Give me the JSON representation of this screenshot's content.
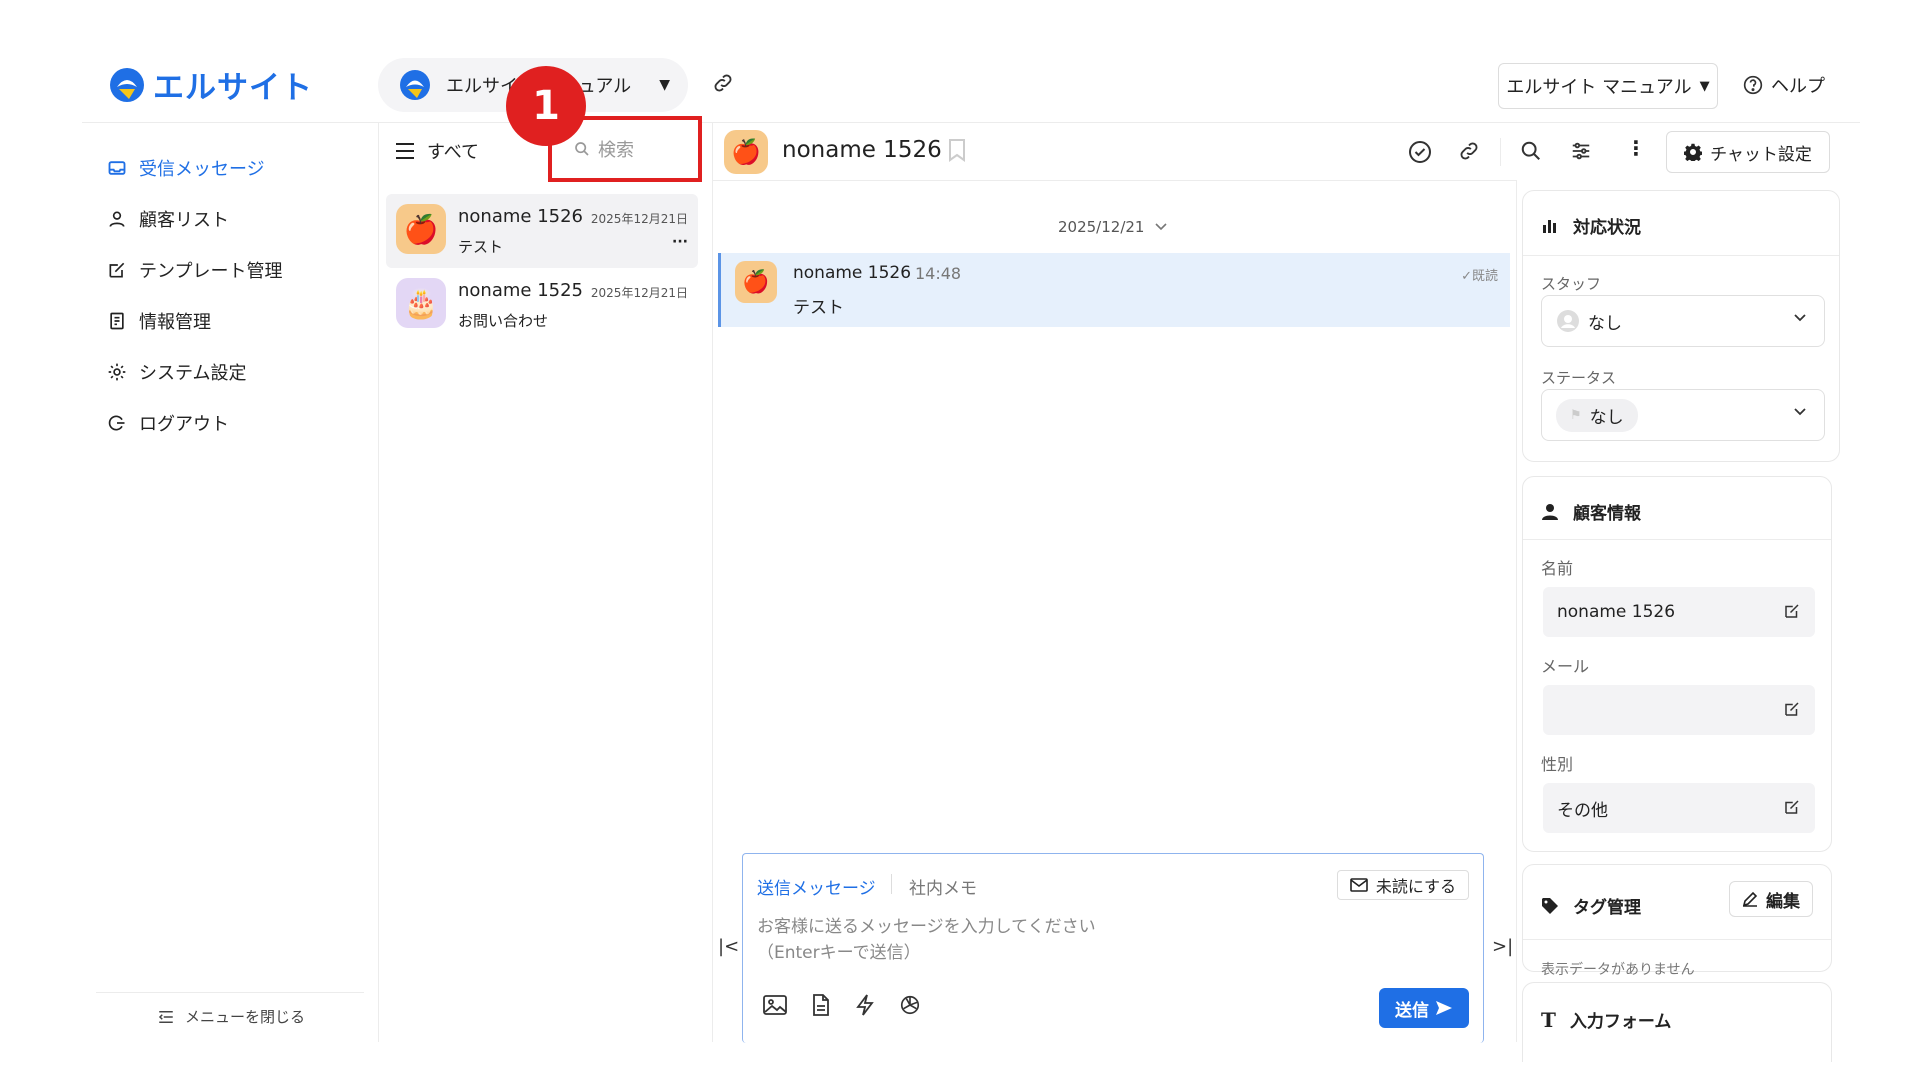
{
  "brand": {
    "name": "エルサイト"
  },
  "account": {
    "name": "エルサイト マニュアル"
  },
  "header": {
    "manual_label": "エルサイト マニュアル",
    "help_label": "ヘルプ"
  },
  "sidebar": {
    "items": [
      {
        "label": "受信メッセージ",
        "icon": "inbox-icon",
        "active": true
      },
      {
        "label": "顧客リスト",
        "icon": "user-icon"
      },
      {
        "label": "テンプレート管理",
        "icon": "edit-icon"
      },
      {
        "label": "情報管理",
        "icon": "info-icon"
      },
      {
        "label": "システム設定",
        "icon": "gear-icon"
      },
      {
        "label": "ログアウト",
        "icon": "logout-icon"
      }
    ],
    "close_label": "メニューを閉じる"
  },
  "list": {
    "filter_label": "すべて",
    "search_placeholder": "検索",
    "annotation_number": "1",
    "conversations": [
      {
        "name": "noname 1526",
        "date": "2025年12月21日",
        "preview": "テスト",
        "avatar": "apple"
      },
      {
        "name": "noname 1525",
        "date": "2025年12月21日",
        "preview": "お問い合わせ",
        "avatar": "cake"
      }
    ]
  },
  "chat": {
    "title": "noname 1526",
    "settings_label": "チャット設定",
    "date_separator": "2025/12/21",
    "messages": [
      {
        "sender": "noname 1526",
        "time": "14:48",
        "status": "既読",
        "text": "テスト"
      }
    ]
  },
  "composer": {
    "tab_send": "送信メッセージ",
    "tab_memo": "社内メモ",
    "unread_label": "未読にする",
    "placeholder_line1": "お客様に送るメッセージを入力してください",
    "placeholder_line2": "（Enterキーで送信）",
    "send_label": "送信"
  },
  "panel": {
    "status_card": {
      "title": "対応状況",
      "staff_label": "スタッフ",
      "staff_value": "なし",
      "status_label": "ステータス",
      "status_value": "なし"
    },
    "customer_card": {
      "title": "顧客情報",
      "name_label": "名前",
      "name_value": "noname 1526",
      "email_label": "メール",
      "email_value": "",
      "gender_label": "性別",
      "gender_value": "その他"
    },
    "tag_card": {
      "title": "タグ管理",
      "edit_label": "編集",
      "empty_text": "表示データがありません"
    },
    "form_card": {
      "title": "入力フォーム"
    }
  },
  "colors": {
    "accent": "#1f6fe5",
    "annotation": "#e02020",
    "selected_message_bg": "#e6f0fc"
  }
}
